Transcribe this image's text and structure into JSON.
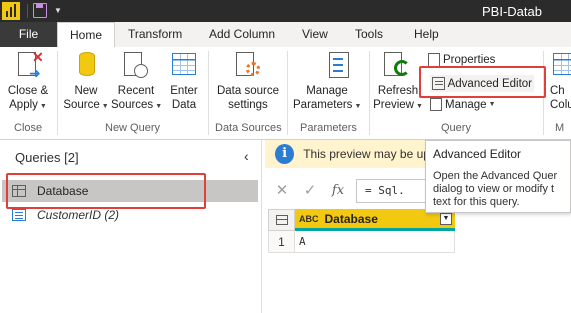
{
  "app": {
    "title": "PBI-Datab",
    "brand_color": "#f2c811",
    "icons": [
      "power-bi-logo-icon",
      "save-icon",
      "customize-toolbar-icon"
    ]
  },
  "tabs": [
    "File",
    "Home",
    "Transform",
    "Add Column",
    "View",
    "Tools",
    "Help"
  ],
  "active_tab": "Home",
  "ribbon": {
    "close_apply": {
      "line1": "Close &",
      "line2": "Apply",
      "icon": "close-apply-icon"
    },
    "new_source": {
      "line1": "New",
      "line2": "Source",
      "icon": "database-icon"
    },
    "recent_sources": {
      "line1": "Recent",
      "line2": "Sources",
      "icon": "recent-sources-icon"
    },
    "enter_data": {
      "line1": "Enter",
      "line2": "Data",
      "icon": "table-icon"
    },
    "data_source_settings": {
      "line1": "Data source",
      "line2": "settings",
      "icon": "settings-icon"
    },
    "manage_parameters": {
      "line1": "Manage",
      "line2": "Parameters",
      "icon": "parameters-icon"
    },
    "refresh_preview": {
      "line1": "Refresh",
      "line2": "Preview",
      "icon": "refresh-icon"
    },
    "properties": "Properties",
    "advanced_editor": "Advanced Editor",
    "manage": "Manage",
    "cut_button_1": "Ch",
    "cut_button_2": "Colu",
    "groups": {
      "close": "Close",
      "new_query": "New Query",
      "data_sources": "Data Sources",
      "parameters": "Parameters",
      "query": "Query",
      "cut_group": "M"
    }
  },
  "tooltip": {
    "title": "Advanced Editor",
    "lines": [
      "Open the Advanced Quer",
      "dialog to view or modify t",
      "text for this query."
    ]
  },
  "queries_pane": {
    "title": "Queries [2]",
    "collapse_icon": "chevron-left-icon",
    "items": [
      {
        "label": "Database",
        "icon": "table-icon",
        "selected": true
      },
      {
        "label": "CustomerID (2)",
        "icon": "list-icon",
        "selected": false
      }
    ]
  },
  "info_bar": {
    "text": "This preview may be up",
    "icon": "info-icon",
    "color": "#fff4ce"
  },
  "formula_bar": {
    "cancel": "✕",
    "confirm": "✓",
    "fx": "fx",
    "formula": "= Sql."
  },
  "grid": {
    "column_type": "ABC",
    "column_name": "Database",
    "rows": [
      {
        "num": "1",
        "value": "A"
      }
    ]
  },
  "highlight_color": "#e0403a"
}
